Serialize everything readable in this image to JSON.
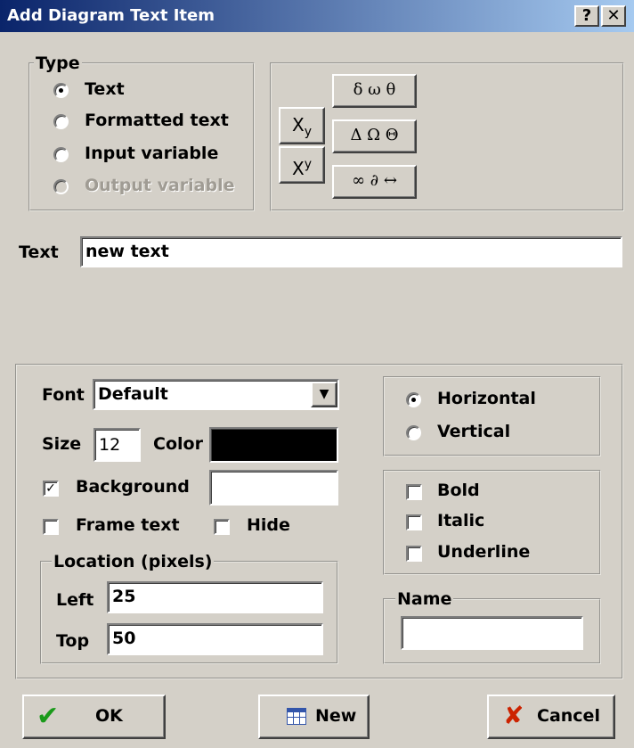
{
  "window": {
    "title": "Add Diagram Text Item",
    "help_label": "?",
    "close_label": "✕"
  },
  "type_group": {
    "label": "Type",
    "options": [
      {
        "label": "Text",
        "checked": true,
        "disabled": false
      },
      {
        "label": "Formatted text",
        "checked": false,
        "disabled": false
      },
      {
        "label": "Input variable",
        "checked": false,
        "disabled": false
      },
      {
        "label": "Output variable",
        "checked": false,
        "disabled": true
      }
    ]
  },
  "format_buttons": {
    "subscript": "Xy",
    "superscript": "Xy",
    "greek_lower": "δ ω θ",
    "greek_upper": "Δ Ω Θ",
    "math_symbols": "∞ ∂ ↔"
  },
  "text_field": {
    "label": "Text",
    "value": "new text"
  },
  "font": {
    "label": "Font",
    "value": "Default",
    "arrow": "▼"
  },
  "size": {
    "label": "Size",
    "value": "12"
  },
  "color": {
    "label": "Color",
    "value": "#000000"
  },
  "background": {
    "label": "Background",
    "checked": true,
    "check_mark": "✓"
  },
  "frame_text": {
    "label": "Frame text",
    "checked": false
  },
  "hide": {
    "label": "Hide",
    "checked": false
  },
  "location": {
    "label": "Location (pixels)",
    "left_label": "Left",
    "left_value": "25",
    "top_label": "Top",
    "top_value": "50"
  },
  "orientation": {
    "horizontal": "Horizontal",
    "vertical": "Vertical",
    "selected": "Horizontal"
  },
  "style": {
    "bold": "Bold",
    "italic": "Italic",
    "underline": "Underline"
  },
  "name": {
    "label": "Name",
    "value": ""
  },
  "buttons": {
    "ok": "OK",
    "new": "New",
    "cancel": "Cancel",
    "ok_icon": "✔",
    "cancel_icon": "✘",
    "colors": {
      "ok": "#1a9a1a",
      "cancel": "#cc2200",
      "new_icon": "#3355aa"
    }
  }
}
